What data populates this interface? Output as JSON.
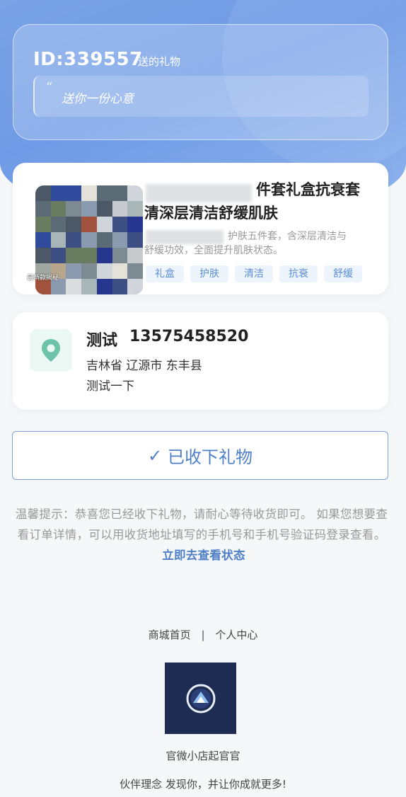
{
  "gift": {
    "id_label": "ID:339557",
    "suffix": "送的礼物",
    "quote_mark": "“",
    "message": "送你一份心意"
  },
  "product": {
    "title_line1": "件套礼盒抗衰套",
    "title_line2": "清深层清洁舒缓肌肤",
    "desc_line1": "护肤五件套，含深层清洁与",
    "desc_line2": "舒缓功效，全面提升肌肤状态。",
    "thumb_caption": "最新款揭秘·",
    "tags": [
      "礼盒",
      "护肤",
      "清洁",
      "抗衰",
      "舒缓"
    ]
  },
  "address": {
    "name": "测试",
    "phone": "13575458520",
    "region": "吉林省 辽源市 东丰县",
    "detail": "测试一下"
  },
  "received_button": {
    "check": "✓",
    "label": "已收下礼物"
  },
  "tip": {
    "text": "温馨提示：恭喜您已经收下礼物，请耐心等待收货即可。 如果您想要查看订单详情，可以用收货地址填写的手机号和手机号验证码登录查看。",
    "link": "立即去查看状态"
  },
  "footer": {
    "home": "商城首页",
    "separator": "|",
    "profile": "个人中心",
    "shop_name": "官微小店起官官",
    "slogan": "伙伴理念 发现你，并让你成就更多!"
  },
  "colors": {
    "accent": "#4f7fc6",
    "hero": "#7aa3e6",
    "pin": "#6cc3a8",
    "logo_bg": "#1e2b52"
  }
}
